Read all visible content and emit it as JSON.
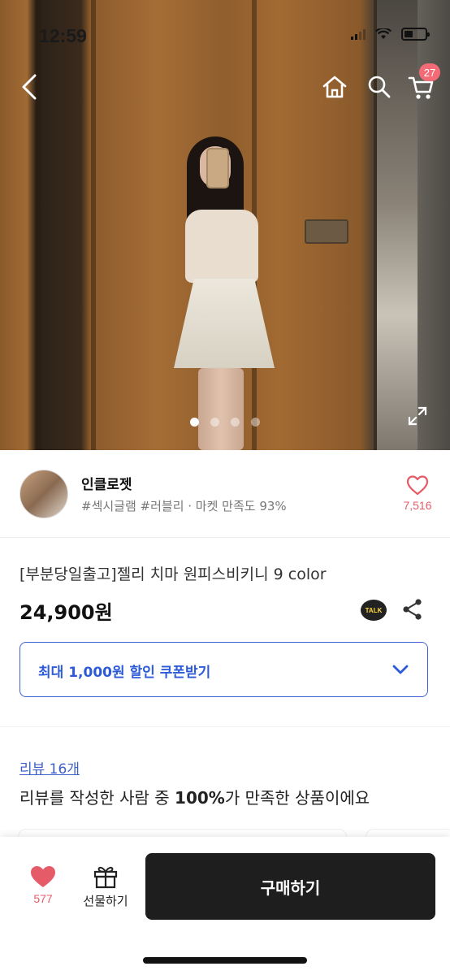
{
  "status_bar": {
    "time": "12:59"
  },
  "top_nav": {
    "cart_badge": "27"
  },
  "hero": {
    "total_images": 4,
    "active_index": 0
  },
  "seller": {
    "name": "인클로젯",
    "tags": "#섹시글램 #러블리 · 마켓 만족도 93%",
    "like_count": "7,516"
  },
  "product": {
    "title": "[부분당일출고]젤리 치마 원피스비키니 9 color",
    "price": "24,900원",
    "talk_label": "TALK"
  },
  "coupon": {
    "label": "최대 1,000원 할인 쿠폰받기"
  },
  "review": {
    "link_label": "리뷰 16개",
    "summary_prefix": "리뷰를 작성한 사람 중 ",
    "summary_percent": "100%",
    "summary_suffix": "가 만족한 상품이에요"
  },
  "bottom_bar": {
    "fav_count": "577",
    "gift_label": "선물하기",
    "buy_label": "구매하기"
  },
  "colors": {
    "accent_blue": "#2d5bd8",
    "like_pink": "#e65b68",
    "badge": "#f36b77",
    "buy_button": "#1e1e1e"
  }
}
